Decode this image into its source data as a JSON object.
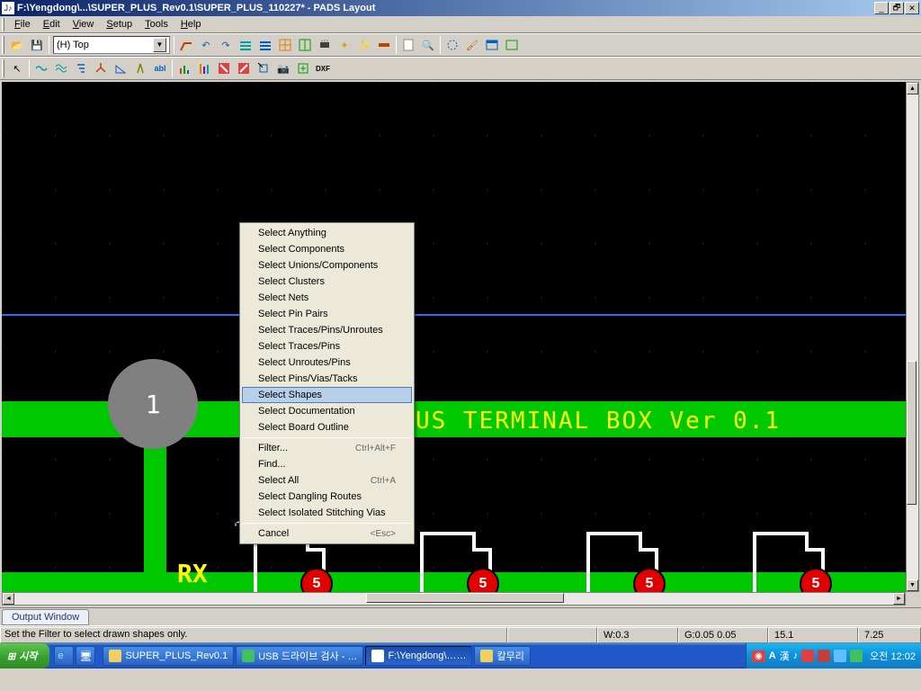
{
  "window": {
    "title": "F:\\Yengdong\\...\\SUPER_PLUS_Rev0.1\\SUPER_PLUS_110227* - PADS Layout",
    "app_icon": "J♪"
  },
  "menu": {
    "file": "File",
    "edit": "Edit",
    "view": "View",
    "setup": "Setup",
    "tools": "Tools",
    "help": "Help"
  },
  "toolbar": {
    "layer": "(H) Top"
  },
  "context_menu": {
    "items": [
      "Select Anything",
      "Select Components",
      "Select Unions/Components",
      "Select Clusters",
      "Select Nets",
      "Select Pin Pairs",
      "Select Traces/Pins/Unroutes",
      "Select Traces/Pins",
      "Select Unroutes/Pins",
      "Select Pins/Vias/Tacks",
      "Select Shapes",
      "Select Documentation",
      "Select Board Outline"
    ],
    "highlighted_index": 10,
    "filter": "Filter...",
    "filter_key": "Ctrl+Alt+F",
    "find": "Find...",
    "select_all": "Select All",
    "select_all_key": "Ctrl+A",
    "dangling": "Select Dangling Routes",
    "isolated": "Select Isolated Stitching Vias",
    "cancel": "Cancel",
    "cancel_key": "<Esc>"
  },
  "pcb": {
    "circle_label": "1",
    "title_text": "US TERMINAL BOX Ver 0.1",
    "rx_label": "RX",
    "pad_number": "5"
  },
  "output_tab": "Output Window",
  "status": {
    "msg": "Set the Filter to select drawn shapes only.",
    "w": "W:0.3",
    "g": "G:0.05 0.05",
    "coord1": "15.1",
    "coord2": "7.25"
  },
  "taskbar": {
    "start": "시작",
    "tasks": [
      "SUPER_PLUS_Rev0.1",
      "USB 드라이브 검사 - …",
      "F:\\Yengdong\\……",
      "칼무리"
    ],
    "active_task_index": 2,
    "ime1": "A",
    "ime2": "漢",
    "clock": "오전 12:02"
  },
  "colors": {
    "tray_icons": [
      "#e04040",
      "#c04040",
      "#40c040",
      "#60c0ff",
      "#40a060"
    ]
  }
}
